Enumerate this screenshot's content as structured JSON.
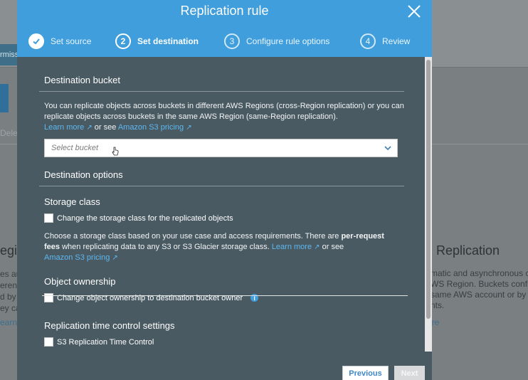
{
  "background": {
    "tab_fragment": "rmiss",
    "delete_fragment": "Delet",
    "left_title": "egi",
    "left_lines": [
      "es au",
      "erent A",
      "d by t",
      "ey ca",
      "cor"
    ],
    "left_link": "earn",
    "right_title": "Replication",
    "right_lines": [
      "matic and asynchronous c",
      "WS Region. Buckets confi",
      "same AWS account or by",
      "nts."
    ],
    "right_link": "ore"
  },
  "modal": {
    "title": "Replication rule",
    "steps": [
      {
        "number": "1",
        "label": "Set source",
        "state": "done"
      },
      {
        "number": "2",
        "label": "Set destination",
        "state": "active"
      },
      {
        "number": "3",
        "label": "Configure rule options",
        "state": "pending"
      },
      {
        "number": "4",
        "label": "Review",
        "state": "pending"
      }
    ],
    "destination_bucket": {
      "title": "Destination bucket",
      "description": "You can replicate objects across buckets in different AWS Regions (cross-Region replication) or you can replicate objects across buckets in the same AWS Region (same-Region replication).",
      "learn_more": "Learn more",
      "or_see": "or see",
      "pricing_link": "Amazon S3 pricing",
      "select_placeholder": "Select bucket"
    },
    "destination_options": {
      "title": "Destination options"
    },
    "storage_class": {
      "title": "Storage class",
      "checkbox_label": "Change the storage class for the replicated objects",
      "desc_1": "Choose a storage class based on your use case and access requirements. There are",
      "desc_bold": "per-request fees",
      "desc_2": "when replicating data to any S3 or S3 Glacier storage class.",
      "learn_more": "Learn more",
      "or": "or",
      "see": "see",
      "pricing_link": "Amazon S3 pricing"
    },
    "object_ownership": {
      "title": "Object ownership",
      "checkbox_label": "Change object ownership to destination bucket owner",
      "info_icon": "i"
    },
    "rtc": {
      "title": "Replication time control settings",
      "checkbox_label": "S3 Replication Time Control"
    },
    "footer": {
      "previous": "Previous",
      "next": "Next"
    }
  },
  "colors": {
    "header": "#3f9edb",
    "modal_body": "#4a5a63",
    "link": "#5cb8f0"
  }
}
